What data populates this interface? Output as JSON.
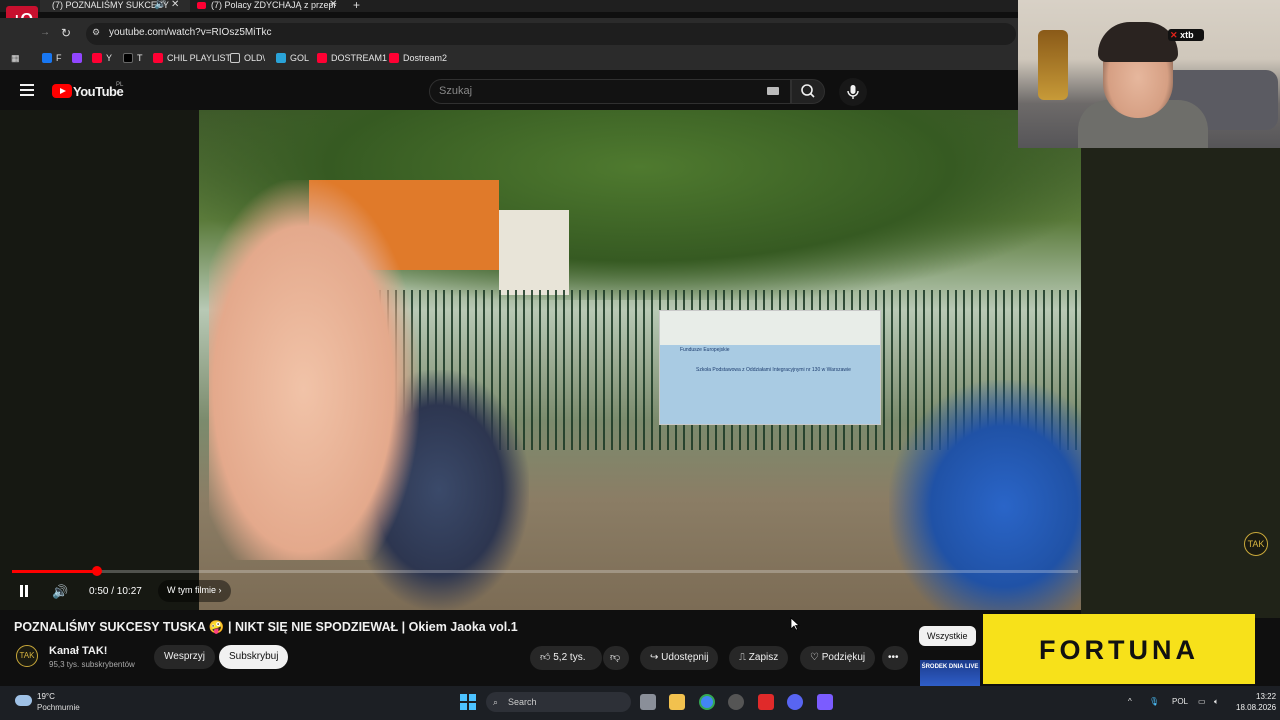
{
  "browser": {
    "tabs": [
      {
        "label": "(7) POZNALIŚMY SUKCESY"
      },
      {
        "label": "(7) Polacy ZDYCHAJĄ z przepr"
      }
    ],
    "url": "youtube.com/watch?v=RIOsz5MiTkc",
    "bookmarks": [
      "F",
      "Y",
      "T",
      "CHIL PLAYLIST",
      "OLD\\",
      "GOL",
      "DOSTREAM1",
      "Dostream2"
    ]
  },
  "youtube": {
    "logo_text": "YouTube",
    "region": "PL",
    "search_placeholder": "Szukaj"
  },
  "player": {
    "time": "0:50 / 10:27",
    "chapter_label": "W tym filmie",
    "progress_fraction": 0.08,
    "banner_lines": [
      "Fundusze Europejskie",
      "Szkoła Podstawowa z Oddziałami Integracyjnymi nr 130 w Warszawie"
    ]
  },
  "video": {
    "title": "POZNALIŚMY SUKCESY TUSKA 🤪 | NIKT SIĘ NIE SPODZIEWAŁ | Okiem Jaoka vol.1",
    "channel": "Kanał TAK!",
    "subscribers": "95,3 tys. subskrybentów",
    "support_label": "Wesprzyj",
    "subscribe_label": "Subskrybuj",
    "likes": "5,2 tys.",
    "share_label": "Udostępnij",
    "save_label": "Zapisz",
    "thanks_label": "Podziękuj"
  },
  "sidebar": {
    "filter_all": "Wszystkie"
  },
  "overlay": {
    "sponsor": "FORTUNA",
    "promo": "ŚRODEK DNIA LIVE",
    "webcam_badge": "xtb"
  },
  "taskbar": {
    "temperature": "19°C",
    "weather": "Pochmurnie",
    "search_label": "Search",
    "language": "POL",
    "time": "13:22",
    "date": "18.08.2026"
  },
  "colors": {
    "youtube_red": "#ff0000",
    "fortuna_yellow": "#f7e11a",
    "windows_accent": "#4cc2ff"
  }
}
